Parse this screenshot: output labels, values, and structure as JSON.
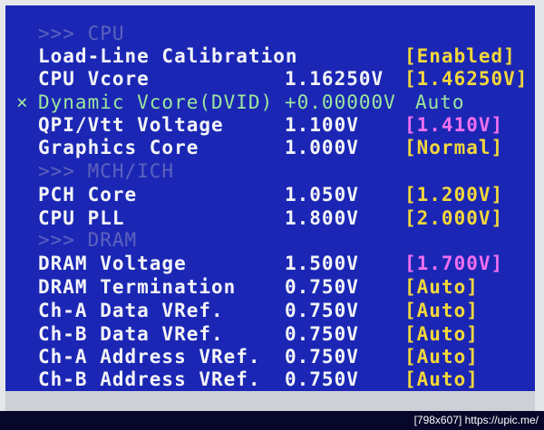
{
  "watermark": "[798x607] https://upic.me/",
  "bios": {
    "rows": [
      {
        "type": "header",
        "label": ">>> CPU"
      },
      {
        "type": "setting",
        "label": "Load-Line Calibration",
        "value": "",
        "setting": "[Enabled]",
        "setting_color": "yellow"
      },
      {
        "type": "setting",
        "label": "CPU Vcore",
        "value": "1.16250V",
        "setting": "[1.46250V]",
        "setting_color": "yellow"
      },
      {
        "type": "dynamic",
        "marker": "×",
        "label": "Dynamic Vcore(DVID)",
        "value": "+0.00000V",
        "setting": "Auto",
        "setting_color": "green"
      },
      {
        "type": "setting",
        "label": "QPI/Vtt Voltage",
        "value": "1.100V",
        "setting": "[1.410V]",
        "setting_color": "magenta"
      },
      {
        "type": "setting",
        "label": "Graphics Core",
        "value": "1.000V",
        "setting": "[Normal]",
        "setting_color": "yellow"
      },
      {
        "type": "header",
        "label": ">>> MCH/ICH"
      },
      {
        "type": "setting",
        "label": "PCH Core",
        "value": "1.050V",
        "setting": "[1.200V]",
        "setting_color": "yellow"
      },
      {
        "type": "setting",
        "label": "CPU PLL",
        "value": "1.800V",
        "setting": "[2.000V]",
        "setting_color": "yellow"
      },
      {
        "type": "header",
        "label": ">>> DRAM"
      },
      {
        "type": "setting",
        "label": "DRAM Voltage",
        "value": "1.500V",
        "setting": "[1.700V]",
        "setting_color": "magenta"
      },
      {
        "type": "setting",
        "label": "DRAM Termination",
        "value": "0.750V",
        "setting": "[Auto]",
        "setting_color": "yellow"
      },
      {
        "type": "setting",
        "label": "Ch-A Data VRef.",
        "value": "0.750V",
        "setting": "[Auto]",
        "setting_color": "yellow"
      },
      {
        "type": "setting",
        "label": "Ch-B Data VRef.",
        "value": "0.750V",
        "setting": "[Auto]",
        "setting_color": "yellow"
      },
      {
        "type": "setting",
        "label": "Ch-A Address VRef.",
        "value": "0.750V",
        "setting": "[Auto]",
        "setting_color": "yellow"
      },
      {
        "type": "setting",
        "label": "Ch-B Address VRef.",
        "value": "0.750V",
        "setting": "[Auto]",
        "setting_color": "yellow"
      }
    ]
  }
}
